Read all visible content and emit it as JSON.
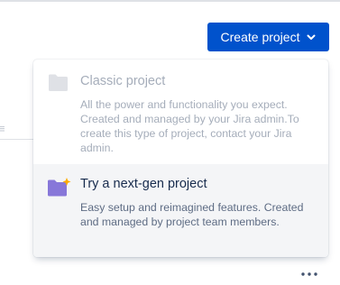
{
  "header": {
    "create_button_label": "Create project"
  },
  "dropdown": {
    "options": [
      {
        "title": "Classic project",
        "description": "All the power and functionality you expect. Created and managed by your Jira admin.To create this type of project, contact your Jira admin.",
        "state": "disabled",
        "icon": "folder-icon"
      },
      {
        "title": "Try a next-gen project",
        "description": "Easy setup and reimagined features. Created and managed by project team members.",
        "state": "highlighted",
        "icon": "folder-sparkle-icon"
      }
    ]
  },
  "footer": {
    "more_icon": "more-icon"
  },
  "colors": {
    "primary": "#0052cc",
    "text_primary": "#172b4d",
    "text_secondary": "#5e6c84",
    "text_disabled": "#a5adba",
    "highlight_bg": "#f4f5f7",
    "folder_purple": "#8777d9",
    "sparkle_yellow": "#ffab00"
  }
}
